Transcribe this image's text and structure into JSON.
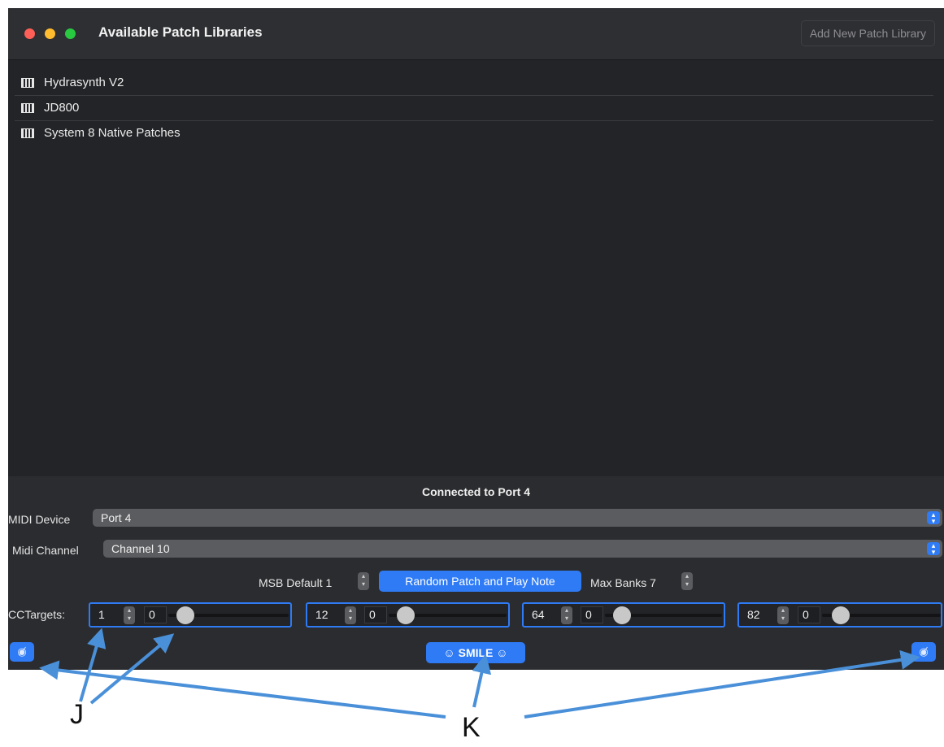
{
  "window": {
    "title": "Available Patch Libraries",
    "add_button": "Add New Patch Library",
    "traffic_lights": {
      "close": "#fe5f57",
      "minimize": "#febc2e",
      "zoom": "#28c840"
    }
  },
  "libraries": [
    {
      "icon": "piano-keys-icon",
      "label": "Hydrasynth V2"
    },
    {
      "icon": "piano-keys-icon",
      "label": "JD800"
    },
    {
      "icon": "piano-keys-icon",
      "label": "System 8 Native Patches"
    }
  ],
  "footer": {
    "status": "Connected to Port 4",
    "midi_device_label": "MIDI Device",
    "midi_device_value": "Port 4",
    "midi_channel_label": "Midi Channel",
    "midi_channel_value": "Channel 10",
    "msb_label": "MSB Default 1",
    "random_button": "Random Patch and Play Note",
    "max_banks_label": "Max Banks 7",
    "cc_label": "CCTargets:",
    "cc_targets": [
      {
        "cc": "1",
        "value": "0"
      },
      {
        "cc": "12",
        "value": "0"
      },
      {
        "cc": "64",
        "value": "0"
      },
      {
        "cc": "82",
        "value": "0"
      }
    ],
    "smile_button": "SMILE",
    "hide_icon_left": "eye-slash-icon",
    "hide_icon_right": "eye-slash-icon",
    "accent_color": "#2f7bf6"
  },
  "annotations": {
    "j": "J",
    "k": "K",
    "arrow_color": "#4a90d9"
  }
}
